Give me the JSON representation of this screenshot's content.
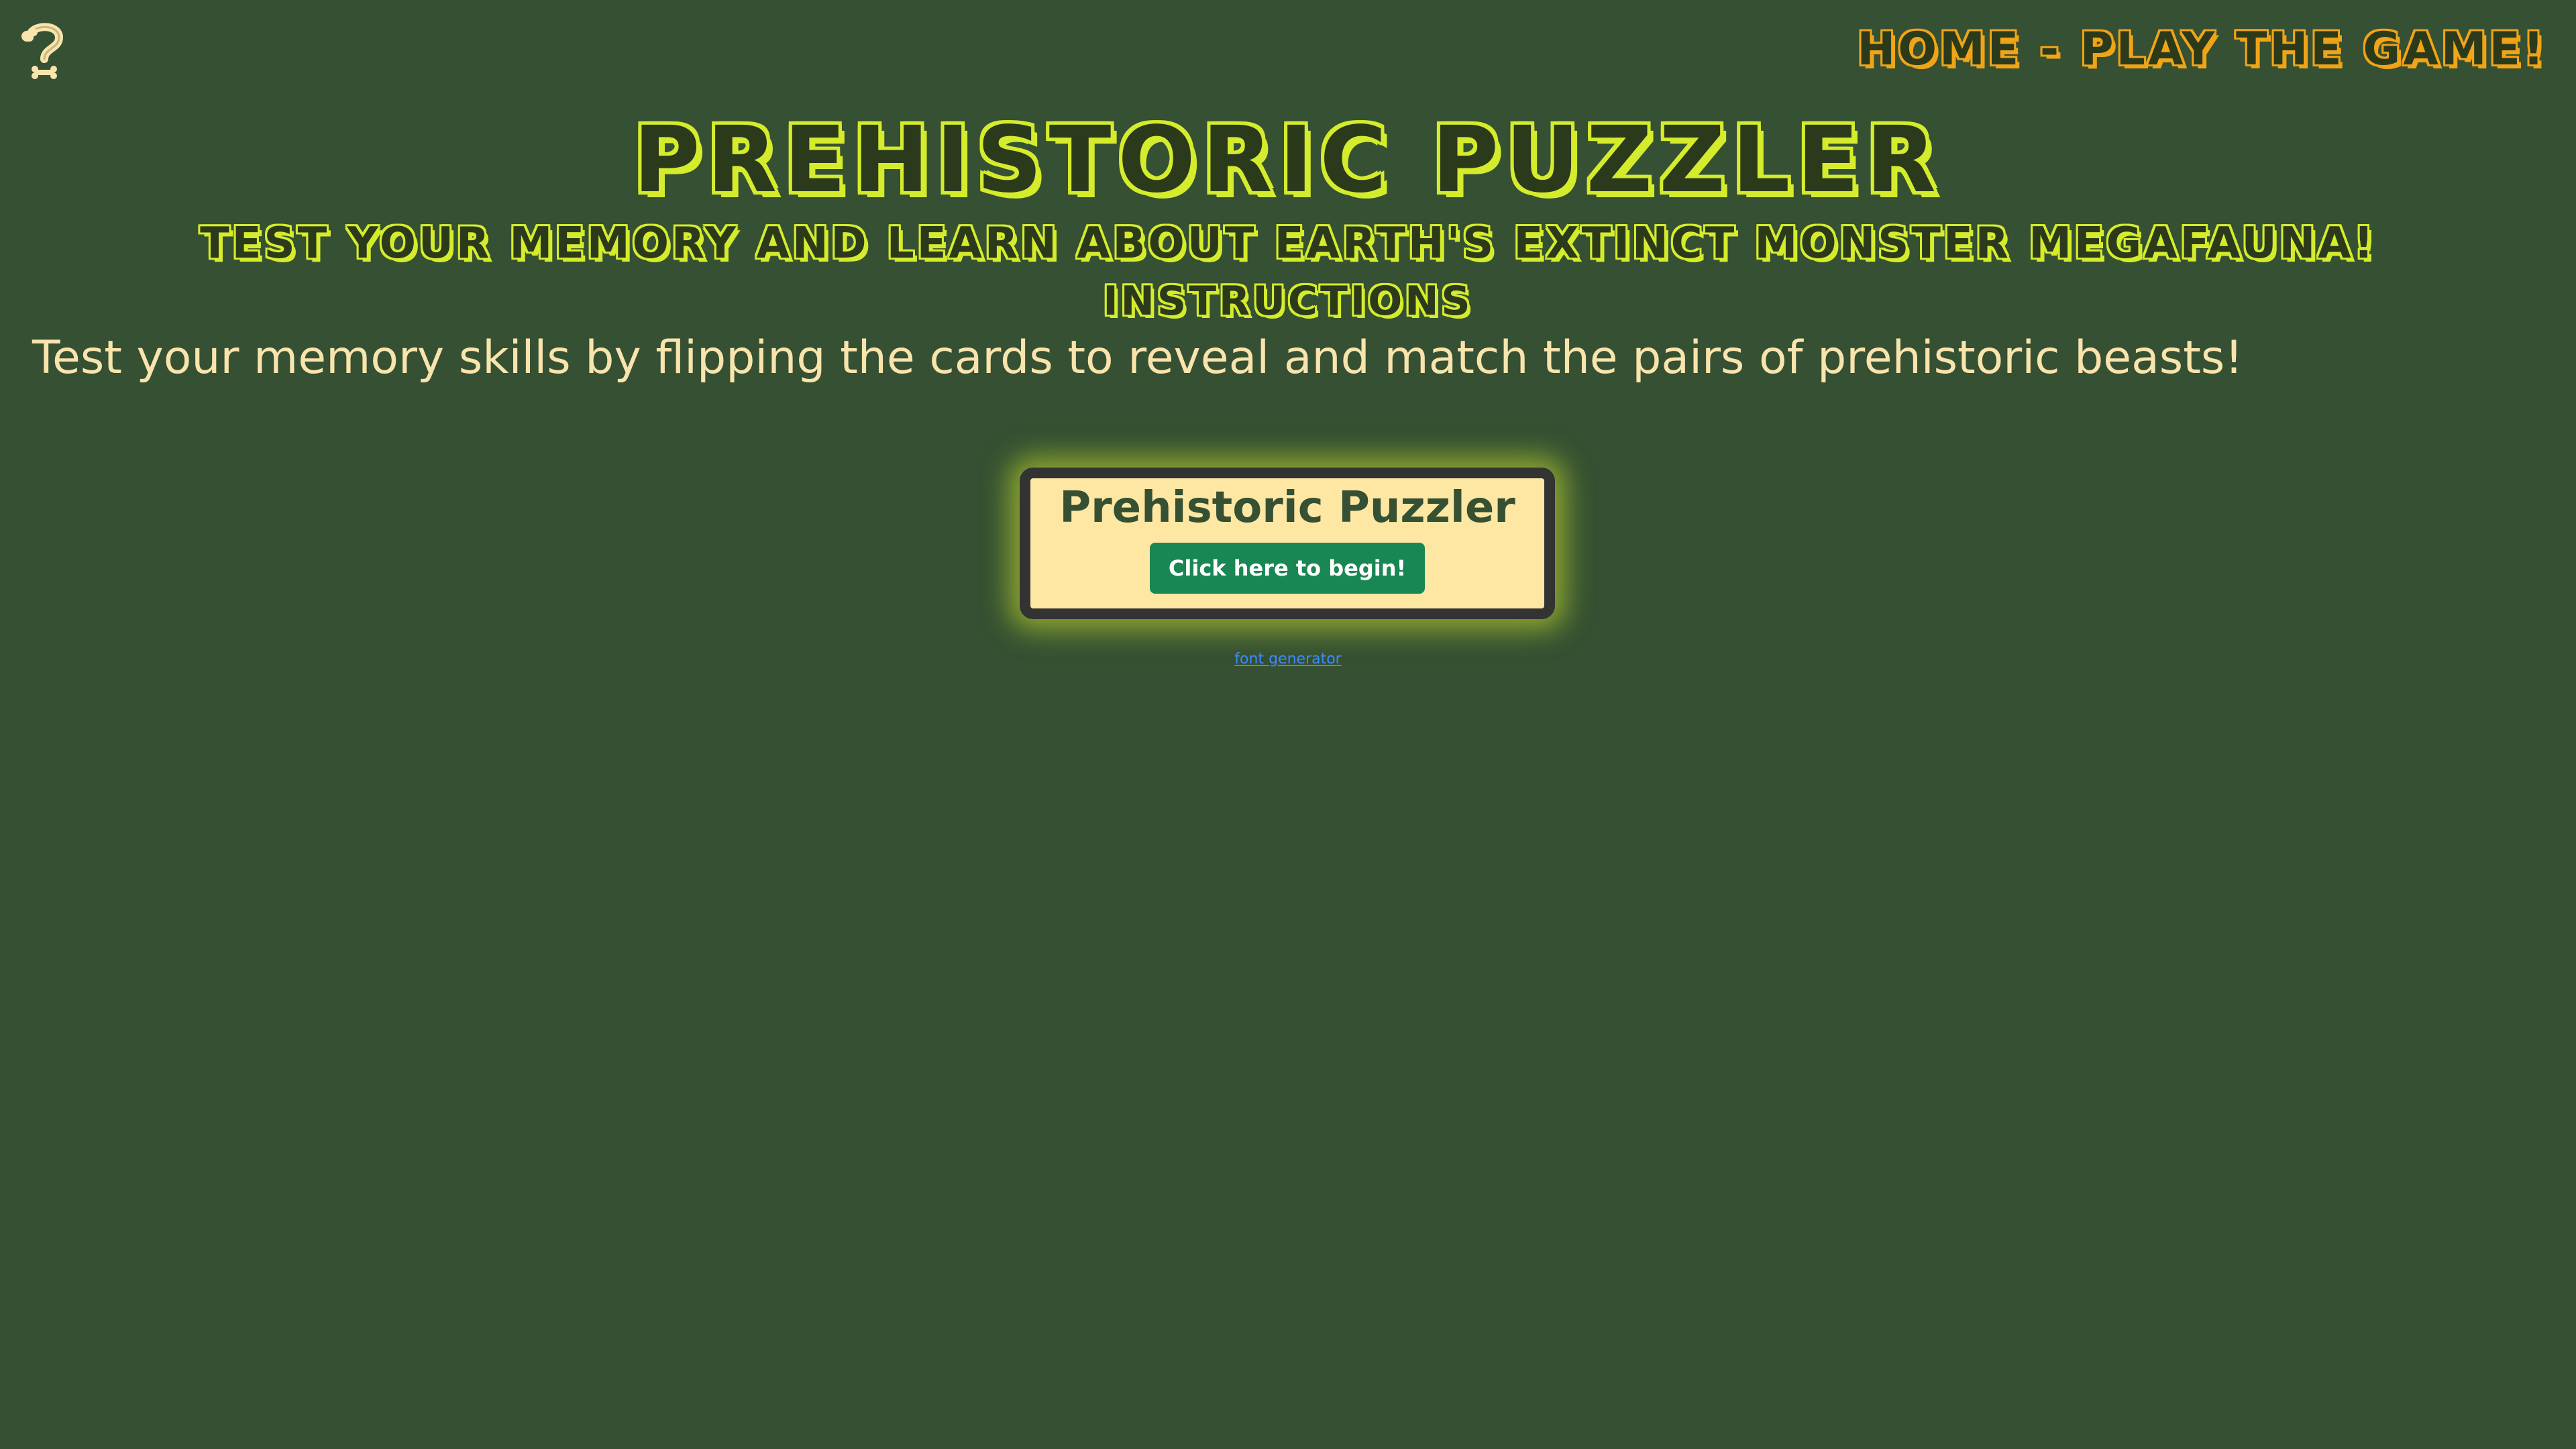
{
  "header": {
    "logo_icon": "question-mark-bone-icon",
    "nav_link": "Home - Play the game!"
  },
  "hero": {
    "title": "Prehistoric Puzzler",
    "subtitle": "Test your memory and learn about Earth's extinct monster megafauna!",
    "section_heading": "Instructions",
    "instructions_text": "Test your memory skills by flipping the cards to reveal and match the pairs of prehistoric beasts!"
  },
  "start_card": {
    "title": "Prehistoric Puzzler",
    "button_label": "Click here to begin!"
  },
  "footer": {
    "credit_link": "font generator"
  },
  "colors": {
    "background": "#355032",
    "title_accent": "#d4ec2c",
    "nav_accent": "#f0a417",
    "text_cream": "#f9e4ad",
    "card_bg": "#fee6a3",
    "button_bg": "#198754"
  }
}
